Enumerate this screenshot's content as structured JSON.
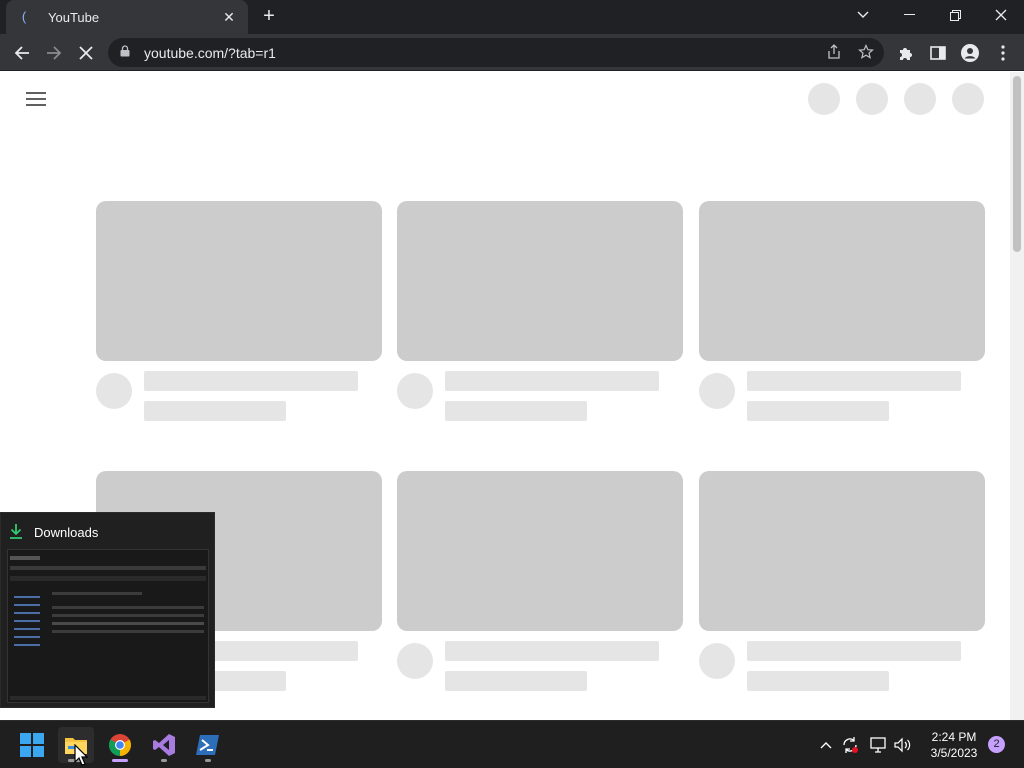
{
  "browser": {
    "tab_title": "YouTube",
    "tab_close": "✕",
    "new_tab": "+",
    "address": "youtube.com/?tab=r1"
  },
  "downloads_preview": {
    "title": "Downloads"
  },
  "taskbar": {
    "clock_time": "2:24 PM",
    "clock_date": "3/5/2023",
    "notification_count": "2",
    "apps": [
      "start",
      "file-explorer",
      "google-chrome",
      "visual-studio",
      "powershell"
    ]
  },
  "colors": {
    "accent_chrome": "#35363a",
    "skeleton_dark": "#cccccc",
    "skeleton_light": "#e5e5e5",
    "download_green": "#2ecc71"
  }
}
